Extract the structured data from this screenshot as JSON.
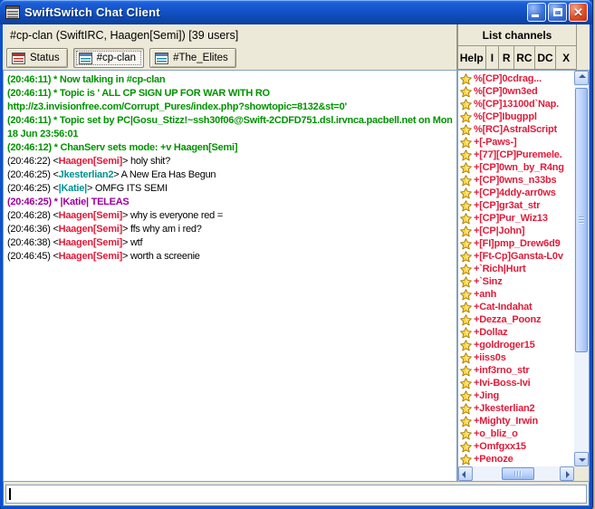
{
  "window": {
    "title": "SwiftSwitch Chat Client"
  },
  "infobar": {
    "channel_info": "#cp-clan (SwiftIRC, Haagen[Semi]) [39 users]",
    "list_channels_label": "List channels"
  },
  "tabs": [
    {
      "label": "Status",
      "icon": "status",
      "active": false
    },
    {
      "label": "#cp-clan",
      "icon": "channel",
      "active": true
    },
    {
      "label": "#The_Elites",
      "icon": "channel",
      "active": false
    }
  ],
  "toolbar": {
    "buttons": [
      "Help",
      "I",
      "R",
      "RC",
      "DC",
      "X"
    ]
  },
  "chat": {
    "messages": [
      {
        "type": "system",
        "time": "(20:46:11)",
        "text": "* Now talking in #cp-clan"
      },
      {
        "type": "system",
        "time": "(20:46:11)",
        "text": "* Topic is ' ALL CP SIGN UP FOR WAR WITH RO http://z3.invisionfree.com/Corrupt_Pures/index.php?showtopic=8132&st=0'"
      },
      {
        "type": "system",
        "time": "(20:46:11)",
        "text": "* Topic set by PC|Gosu_Stizz!~ssh30f06@Swift-2CDFD751.dsl.irvnca.pacbell.net on Mon 18 Jun 23:56:01"
      },
      {
        "type": "system",
        "time": "(20:46:12)",
        "text": "* ChanServ sets mode: +v Haagen[Semi]"
      },
      {
        "type": "chat",
        "time": "(20:46:22)",
        "nick": "Haagen[Semi]",
        "nick_color": "red",
        "text": "holy shit?"
      },
      {
        "type": "chat",
        "time": "(20:46:25)",
        "nick": "Jkesterlian2",
        "nick_color": "teal",
        "text": "A New Era Has Begun"
      },
      {
        "type": "chat",
        "time": "(20:46:25)",
        "nick": "|Katie|",
        "nick_color": "teal",
        "text": "OMFG ITS SEMI"
      },
      {
        "type": "action",
        "time": "(20:46:25)",
        "text": "* |Katie| TELEAS"
      },
      {
        "type": "chat",
        "time": "(20:46:28)",
        "nick": "Haagen[Semi]",
        "nick_color": "red",
        "text": "why is everyone red ="
      },
      {
        "type": "chat",
        "time": "(20:46:36)",
        "nick": "Haagen[Semi]",
        "nick_color": "red",
        "text": "ffs why am i red?"
      },
      {
        "type": "chat",
        "time": "(20:46:38)",
        "nick": "Haagen[Semi]",
        "nick_color": "red",
        "text": "wtf"
      },
      {
        "type": "chat",
        "time": "(20:46:45)",
        "nick": "Haagen[Semi]",
        "nick_color": "red",
        "text": "worth a screenie"
      }
    ]
  },
  "userlist": {
    "users": [
      "%[CP]0cdrag...",
      "%[CP]0wn3ed",
      "%[CP]13100d`Nap.",
      "%[CP]Ibugppl",
      "%[RC]AstralScript",
      "+[-Paws-]",
      "+[77][CP]Puremele.",
      "+[CP]0wn_by_R4ng",
      "+[CP]0wns_n33bs",
      "+[CP]4ddy-arr0ws",
      "+[CP]gr3at_str",
      "+[CP]Pur_Wiz13",
      "+[CP|John]",
      "+[FI]pmp_Drew6d9",
      "+[Ft-Cp]Gansta-L0v",
      "+`Rich|Hurt",
      "+`Sinz",
      "+anh",
      "+Cat-Indahat",
      "+Dezza_Poonz",
      "+Dollaz",
      "+goldroger15",
      "+iiss0s",
      "+inf3rno_str",
      "+Ivi-Boss-Ivi",
      "+Jing",
      "+Jkesterlian2",
      "+Mighty_Irwin",
      "+o_bliz_o",
      "+Omfgxx15",
      "+Penoze"
    ]
  },
  "input": {
    "value": ""
  },
  "colors": {
    "system_green": "#009300",
    "action_purple": "#9c009c",
    "nick_red": "#df1c3a",
    "nick_teal": "#009191",
    "user_red": "#df1c3a",
    "titlebar_blue": "#1252c6",
    "star_gold": "#ffd23e"
  }
}
